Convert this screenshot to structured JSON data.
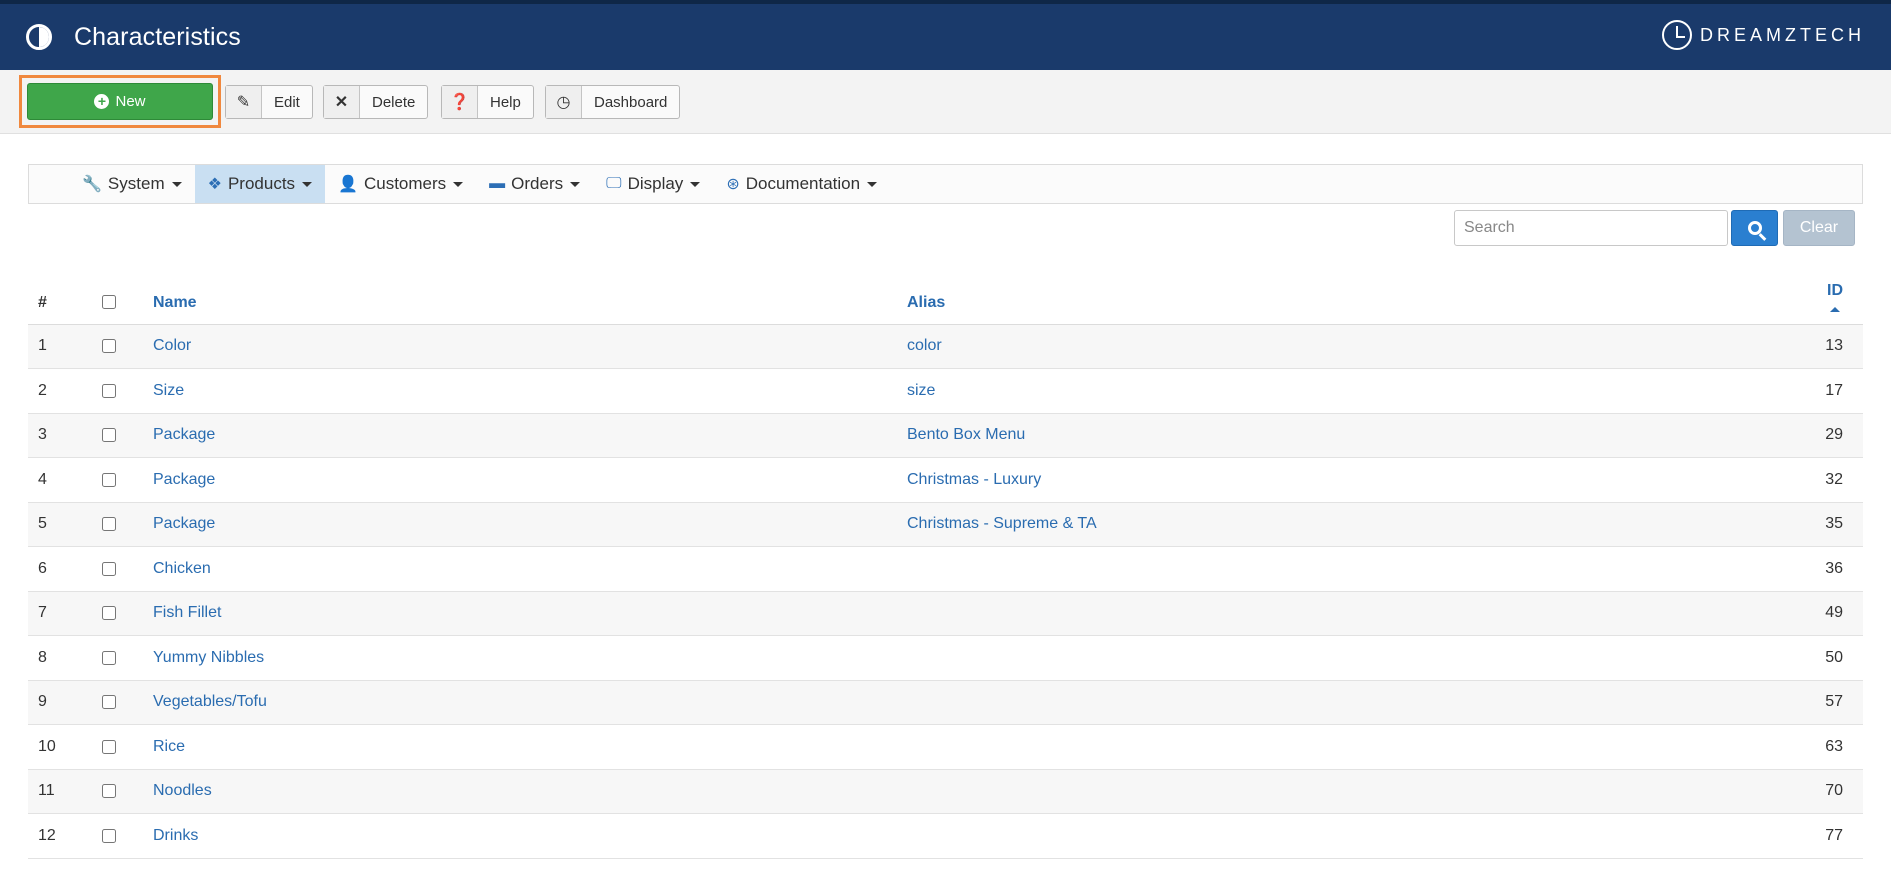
{
  "header": {
    "title": "Characteristics",
    "brand": "DREAMZTECH"
  },
  "toolbar": {
    "new_label": "New",
    "edit_label": "Edit",
    "delete_label": "Delete",
    "help_label": "Help",
    "dashboard_label": "Dashboard",
    "highlight_color": "#f0883e"
  },
  "nav": {
    "items": [
      {
        "label": "System",
        "icon": "wrench-icon"
      },
      {
        "label": "Products",
        "icon": "cubes-icon",
        "active": true
      },
      {
        "label": "Customers",
        "icon": "user-icon"
      },
      {
        "label": "Orders",
        "icon": "credit-card-icon"
      },
      {
        "label": "Display",
        "icon": "monitor-icon"
      },
      {
        "label": "Documentation",
        "icon": "life-ring-icon"
      }
    ]
  },
  "search": {
    "placeholder": "Search",
    "clear_label": "Clear"
  },
  "table": {
    "columns": {
      "num": "#",
      "name": "Name",
      "alias": "Alias",
      "id": "ID"
    },
    "rows": [
      {
        "num": "1",
        "name": "Color",
        "alias": "color",
        "id": "13"
      },
      {
        "num": "2",
        "name": "Size",
        "alias": "size",
        "id": "17"
      },
      {
        "num": "3",
        "name": "Package",
        "alias": "Bento Box Menu",
        "id": "29"
      },
      {
        "num": "4",
        "name": "Package",
        "alias": "Christmas - Luxury",
        "id": "32"
      },
      {
        "num": "5",
        "name": "Package",
        "alias": "Christmas - Supreme & TA",
        "id": "35"
      },
      {
        "num": "6",
        "name": "Chicken",
        "alias": "",
        "id": "36"
      },
      {
        "num": "7",
        "name": "Fish Fillet",
        "alias": "",
        "id": "49"
      },
      {
        "num": "8",
        "name": "Yummy Nibbles",
        "alias": "",
        "id": "50"
      },
      {
        "num": "9",
        "name": "Vegetables/Tofu",
        "alias": "",
        "id": "57"
      },
      {
        "num": "10",
        "name": "Rice",
        "alias": "",
        "id": "63"
      },
      {
        "num": "11",
        "name": "Noodles",
        "alias": "",
        "id": "70"
      },
      {
        "num": "12",
        "name": "Drinks",
        "alias": "",
        "id": "77"
      }
    ]
  }
}
